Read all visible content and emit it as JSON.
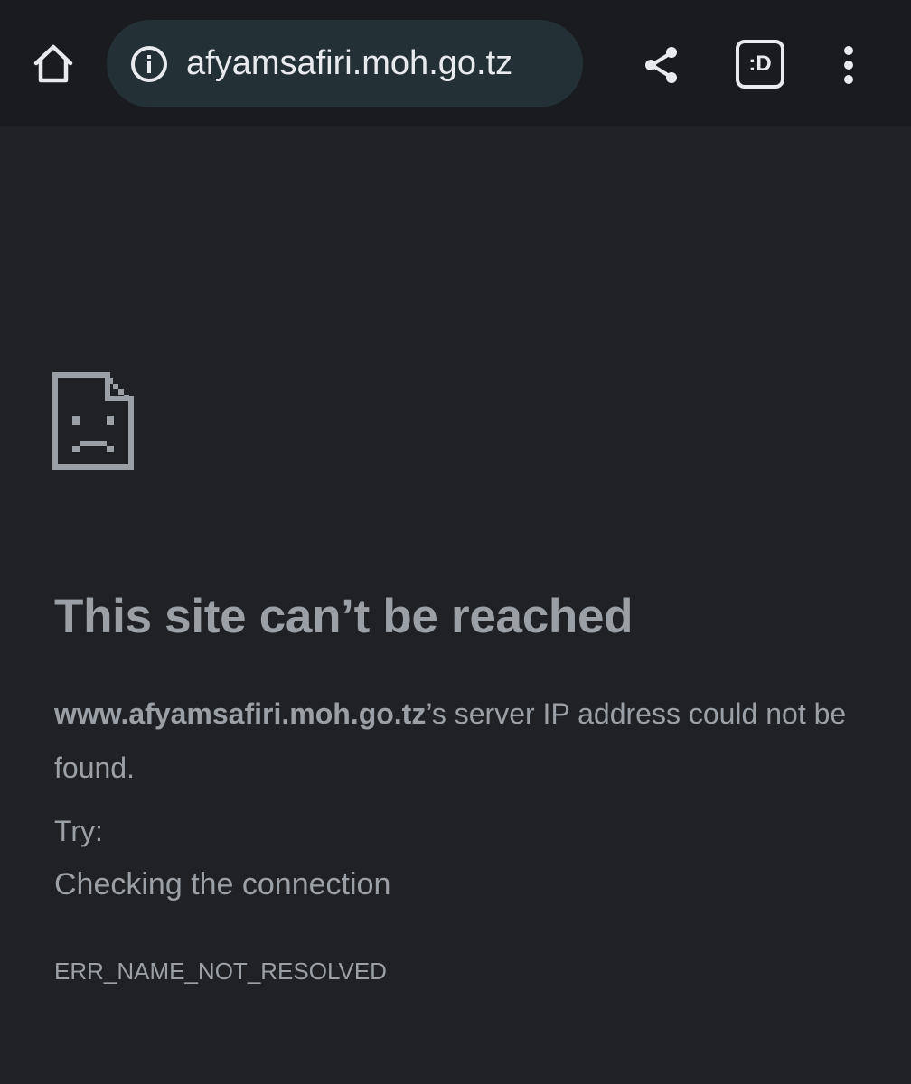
{
  "toolbar": {
    "url": "afyamsafiri.moh.go.tz",
    "tabs_label": ":D",
    "icons": {
      "home": "home-icon",
      "info": "info-icon",
      "share": "share-icon",
      "tabs": "tab-switcher-icon",
      "menu": "more-vert-icon"
    }
  },
  "error_page": {
    "icon": "sad-page-icon",
    "title": "This site can’t be reached",
    "host": "www.afyamsafiri.moh.go.tz",
    "message_rest": "’s server IP address could not be found.",
    "try_label": "Try:",
    "suggestion": "Checking the connection",
    "error_code": "ERR_NAME_NOT_RESOLVED"
  },
  "colors": {
    "background": "#202124",
    "toolbar": "#1a1b1e",
    "omnibox": "#233036",
    "text": "#9aa0a6",
    "icon": "#e8eaed"
  }
}
